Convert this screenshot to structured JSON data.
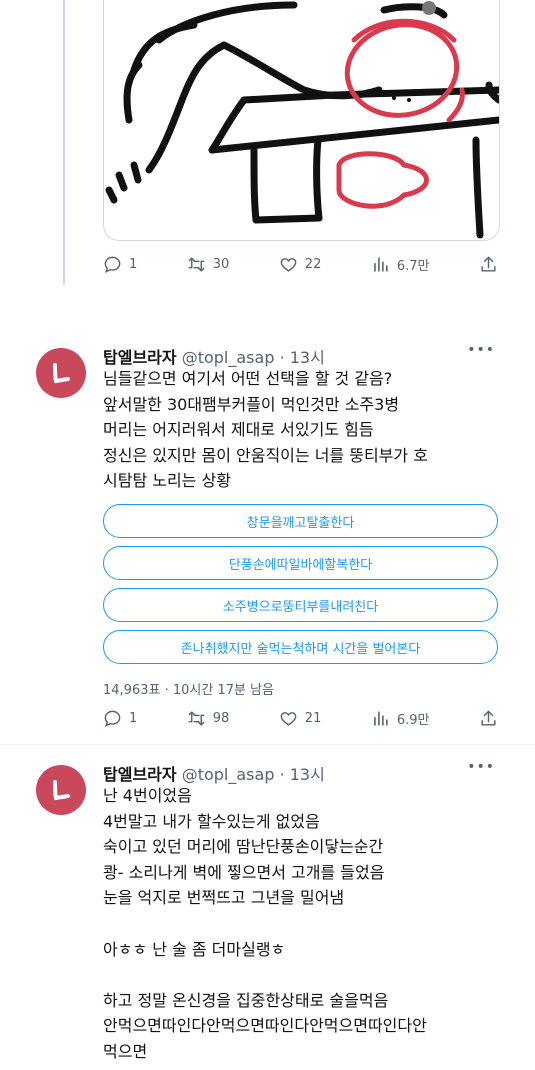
{
  "tweet1": {
    "actions": {
      "reply": "1",
      "retweet": "30",
      "like": "22",
      "views": "6.7만"
    }
  },
  "tweet2": {
    "header": {
      "name": "탑엘브라자",
      "handle": "@topl_asap",
      "time": "· 13시"
    },
    "text": "님들같으면 여기서 어떤 선택을 할 것 같음?\n앞서말한 30대팸부커플이 먹인것만 소주3병\n머리는 어지러워서 제대로 서있기도 힘듬\n정신은 있지만 몸이 안움직이는 너를 뚱티부가 호\n시탐탐 노리는 상황",
    "poll_options": [
      "창문을깨고탈출한다",
      "단풍손에따일바에할복한다",
      "소주병으로뚱티부를내려친다",
      "존나취했지만 술먹는척하며 시간을 벌어본다"
    ],
    "poll_meta": "14,963표 · 10시간 17분 남음",
    "actions": {
      "reply": "1",
      "retweet": "98",
      "like": "21",
      "views": "6.9만"
    }
  },
  "tweet3": {
    "header": {
      "name": "탑엘브라자",
      "handle": "@topl_asap",
      "time": "· 13시"
    },
    "text": "난 4번이었음\n4번말고 내가 할수있는게 없었음\n숙이고 있던 머리에 땀난단풍손이닿는순간\n쾅- 소리나게 벽에 찧으면서 고개를 들었음\n눈을 억지로 번쩍뜨고 그년을 밀어냄\n\n아ㅎㅎ 난 술 좀 더마실랭ㅎ\n\n하고 정말 온신경을 집중한상태로 술을먹음\n안먹으면따인다안먹으면따인다안먹으면따인다안\n먹으면"
  },
  "colors": {
    "accent": "#1d9bf0",
    "avatar": "#c9485b",
    "muted": "#536471"
  }
}
